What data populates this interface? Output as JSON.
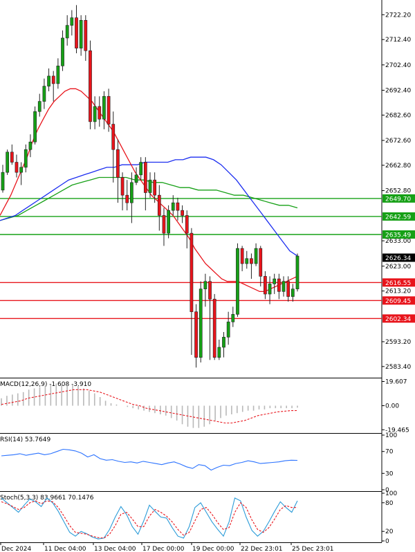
{
  "chart_data": {
    "type": "candlestick",
    "main": {
      "price_axis_ticks": [
        "2722.20",
        "2712.40",
        "2702.40",
        "2692.40",
        "2682.60",
        "2672.60",
        "2662.80",
        "2652.80",
        "2633.00",
        "2623.00",
        "2613.20",
        "2593.20",
        "2583.40"
      ],
      "ylim": [
        2579,
        2728
      ],
      "resistance_levels": [
        {
          "value": 2649.7,
          "label": "2649.70",
          "color": "#16a016"
        },
        {
          "value": 2642.59,
          "label": "2642.59",
          "color": "#16a016"
        },
        {
          "value": 2635.49,
          "label": "2635.49",
          "color": "#16a016"
        }
      ],
      "support_levels": [
        {
          "value": 2616.55,
          "label": "2616.55",
          "color": "#e8141b"
        },
        {
          "value": 2609.45,
          "label": "2609.45",
          "color": "#e8141b"
        },
        {
          "value": 2602.34,
          "label": "2602.34",
          "color": "#e8141b"
        }
      ],
      "current_price": {
        "value": 2626.34,
        "label": "2626.34"
      },
      "candles": [
        [
          2653,
          2660,
          2652,
          2663
        ],
        [
          2660,
          2668,
          2659,
          2669
        ],
        [
          2668,
          2664,
          2663,
          2671
        ],
        [
          2664,
          2660,
          2658,
          2667
        ],
        [
          2660,
          2662,
          2655,
          2664
        ],
        [
          2662,
          2669,
          2660,
          2671
        ],
        [
          2669,
          2672,
          2666,
          2675
        ],
        [
          2672,
          2684,
          2671,
          2686
        ],
        [
          2684,
          2688,
          2682,
          2691
        ],
        [
          2688,
          2694,
          2685,
          2697
        ],
        [
          2694,
          2698,
          2692,
          2701
        ],
        [
          2698,
          2695,
          2688,
          2700
        ],
        [
          2695,
          2702,
          2693,
          2705
        ],
        [
          2702,
          2713,
          2700,
          2716
        ],
        [
          2713,
          2718,
          2710,
          2722
        ],
        [
          2718,
          2721,
          2714,
          2724
        ],
        [
          2721,
          2709,
          2707,
          2726
        ],
        [
          2709,
          2720,
          2706,
          2722
        ],
        [
          2720,
          2708,
          2704,
          2722
        ],
        [
          2708,
          2680,
          2677,
          2712
        ],
        [
          2680,
          2686,
          2677,
          2690
        ],
        [
          2686,
          2681,
          2678,
          2690
        ],
        [
          2681,
          2690,
          2677,
          2692
        ],
        [
          2690,
          2679,
          2676,
          2693
        ],
        [
          2679,
          2669,
          2656,
          2684
        ],
        [
          2669,
          2658,
          2648,
          2673
        ],
        [
          2658,
          2651,
          2645,
          2660
        ],
        [
          2651,
          2648,
          2645,
          2657
        ],
        [
          2648,
          2656,
          2640,
          2660
        ],
        [
          2656,
          2659,
          2655,
          2662
        ],
        [
          2659,
          2664,
          2657,
          2666
        ],
        [
          2664,
          2652,
          2645,
          2666
        ],
        [
          2652,
          2657,
          2650,
          2660
        ],
        [
          2657,
          2651,
          2648,
          2660
        ],
        [
          2651,
          2643,
          2637,
          2655
        ],
        [
          2643,
          2636,
          2631,
          2646
        ],
        [
          2636,
          2645,
          2634,
          2647
        ],
        [
          2645,
          2648,
          2643,
          2651
        ],
        [
          2648,
          2645,
          2641,
          2650
        ],
        [
          2645,
          2643,
          2640,
          2647
        ],
        [
          2643,
          2636,
          2630,
          2645
        ],
        [
          2636,
          2605,
          2588,
          2638
        ],
        [
          2605,
          2587,
          2583,
          2608
        ],
        [
          2587,
          2614,
          2585,
          2617
        ],
        [
          2614,
          2617,
          2607,
          2620
        ],
        [
          2617,
          2610,
          2586,
          2619
        ],
        [
          2610,
          2587,
          2586,
          2612
        ],
        [
          2587,
          2591,
          2586,
          2594
        ],
        [
          2591,
          2595,
          2587,
          2597
        ],
        [
          2595,
          2601,
          2592,
          2605
        ],
        [
          2601,
          2604,
          2599,
          2607
        ],
        [
          2604,
          2630,
          2603,
          2632
        ],
        [
          2630,
          2624,
          2621,
          2631
        ],
        [
          2624,
          2626,
          2622,
          2629
        ],
        [
          2626,
          2624,
          2618,
          2628
        ],
        [
          2624,
          2630,
          2623,
          2632
        ],
        [
          2630,
          2619,
          2615,
          2631
        ],
        [
          2619,
          2612,
          2610,
          2621
        ],
        [
          2612,
          2616,
          2608,
          2619
        ],
        [
          2616,
          2618,
          2612,
          2620
        ],
        [
          2618,
          2613,
          2610,
          2620
        ],
        [
          2613,
          2617,
          2611,
          2619
        ],
        [
          2617,
          2611,
          2609,
          2619
        ],
        [
          2611,
          2614,
          2609,
          2616
        ],
        [
          2614,
          2627,
          2613,
          2628
        ]
      ],
      "ma_fast": [
        2643,
        2647,
        2651,
        2656,
        2661,
        2666,
        2672,
        2677,
        2681,
        2685,
        2688,
        2690,
        2692,
        2693,
        2693,
        2692,
        2690,
        2688,
        2685,
        2682,
        2679,
        2676,
        2672,
        2668,
        2664,
        2660,
        2657,
        2654,
        2651,
        2649,
        2647,
        2645,
        2643,
        2640,
        2637,
        2634,
        2630,
        2627,
        2624,
        2622,
        2620,
        2618,
        2617,
        2617,
        2617,
        2616,
        2615,
        2614,
        2613,
        2613,
        2614,
        2615,
        2616,
        2617,
        2618,
        2619
      ],
      "ma_mid": [
        2641,
        2642,
        2643,
        2645,
        2647,
        2649,
        2651,
        2653,
        2655,
        2657,
        2658,
        2659,
        2660,
        2661,
        2662,
        2662,
        2663,
        2663,
        2663,
        2664,
        2664,
        2664,
        2664,
        2665,
        2665,
        2666,
        2666,
        2666,
        2665,
        2663,
        2660,
        2657,
        2653,
        2649,
        2645,
        2641,
        2637,
        2633,
        2629,
        2627
      ],
      "ma_slow": [
        2641,
        2642,
        2643,
        2645,
        2647,
        2649,
        2651,
        2653,
        2655,
        2656,
        2657,
        2658,
        2658,
        2658,
        2658,
        2657,
        2657,
        2656,
        2656,
        2655,
        2654,
        2654,
        2653,
        2653,
        2653,
        2652,
        2651,
        2651,
        2650,
        2649,
        2648,
        2647,
        2647,
        2646
      ]
    },
    "macd": {
      "label": "MACD(12,26,9) -1.608 -3.910",
      "ticks": [
        "19.607",
        "0.00",
        "-19.465"
      ],
      "ylim": [
        -21,
        21
      ],
      "hist": [
        6,
        8,
        9,
        10,
        11,
        13,
        14,
        15,
        16,
        17,
        18,
        18,
        18,
        17,
        16,
        14,
        12,
        10,
        7,
        4,
        2,
        1,
        0,
        -1,
        -2,
        -3,
        -4,
        -5,
        -6,
        -7,
        -8,
        -10,
        -12,
        -15,
        -17,
        -18,
        -18,
        -17,
        -15,
        -12,
        -10,
        -8,
        -7,
        -6,
        -5,
        -4,
        -4,
        -3,
        -3,
        -2,
        -2,
        -2,
        -2,
        -2,
        -1.6
      ],
      "signal": [
        1,
        2,
        3,
        4,
        6,
        7,
        8,
        9,
        10,
        11,
        12,
        13,
        13,
        13,
        12,
        11,
        9,
        7,
        5,
        3,
        1,
        0,
        -2,
        -3,
        -4,
        -5,
        -6,
        -7,
        -8,
        -9,
        -10,
        -11,
        -12,
        -13,
        -14,
        -14,
        -13,
        -12,
        -10,
        -8,
        -7,
        -6,
        -5,
        -4.5,
        -4,
        -3.9
      ]
    },
    "rsi": {
      "label": "RSI(14) 53.7649",
      "ticks": [
        "100",
        "70",
        "30",
        "0"
      ],
      "ylim": [
        0,
        100
      ],
      "values": [
        62,
        63,
        64,
        66,
        63,
        65,
        67,
        64,
        66,
        70,
        74,
        73,
        71,
        67,
        60,
        64,
        57,
        54,
        55,
        52,
        50,
        51,
        49,
        52,
        50,
        48,
        46,
        49,
        51,
        47,
        42,
        39,
        46,
        44,
        36,
        41,
        45,
        44,
        48,
        50,
        53,
        51,
        48,
        49,
        50,
        51,
        53,
        54,
        53.76
      ]
    },
    "stoch": {
      "label": "Stoch(5,3,3) 83.9661 70.1476",
      "ticks": [
        "100",
        "80",
        "20",
        "0"
      ],
      "ylim": [
        0,
        100
      ],
      "k": [
        90,
        80,
        70,
        60,
        75,
        88,
        82,
        72,
        90,
        80,
        62,
        40,
        18,
        10,
        20,
        15,
        8,
        4,
        6,
        24,
        50,
        72,
        55,
        30,
        14,
        42,
        75,
        62,
        50,
        48,
        28,
        10,
        6,
        30,
        70,
        80,
        60,
        40,
        24,
        10,
        40,
        90,
        84,
        50,
        22,
        10,
        20,
        40,
        62,
        82,
        70,
        60,
        84
      ],
      "d": [
        82,
        78,
        72,
        66,
        70,
        80,
        84,
        78,
        84,
        82,
        70,
        52,
        32,
        18,
        16,
        14,
        10,
        7,
        6,
        14,
        32,
        56,
        60,
        46,
        30,
        30,
        52,
        66,
        60,
        52,
        40,
        24,
        12,
        18,
        42,
        66,
        70,
        56,
        38,
        24,
        28,
        60,
        80,
        70,
        44,
        24,
        18,
        28,
        46,
        66,
        74,
        70,
        70
      ]
    },
    "time_axis": [
      "Dec 2024",
      "11 Dec 04:00",
      "13 Dec 04:00",
      "17 Dec 00:00",
      "19 Dec 00:00",
      "22 Dec 23:01",
      "25 Dec 23:01"
    ]
  },
  "colors": {
    "bull": "#16a016",
    "bear": "#e8141b",
    "ma_fast": "#e8141b",
    "ma_mid": "#1c2ef0",
    "ma_slow": "#16a016",
    "support": "#e8141b",
    "resistance": "#16a016",
    "current_tag": "#000000",
    "macd_hist": "#b8b8b8",
    "macd_signal": "#e8141b",
    "rsi": "#2a72ff",
    "stoch_k": "#2a9bd8",
    "stoch_d": "#e8141b"
  }
}
